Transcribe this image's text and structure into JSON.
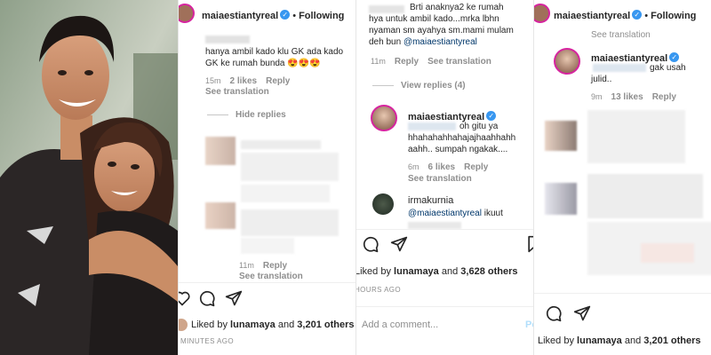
{
  "panel2": {
    "header": {
      "username": "maiaestiantyreal",
      "following": "Following"
    },
    "comment1": {
      "text": "hanya ambil kado klu GK ada kado GK ke rumah bunda",
      "emojis": "😍😍😍",
      "time": "15m",
      "likes": "2 likes",
      "reply": "Reply",
      "see_translation": "See translation"
    },
    "hide_replies": "Hide replies",
    "comment2": {
      "time": "11m",
      "reply": "Reply",
      "see_translation": "See translation"
    },
    "likes": {
      "prefix": "Liked by",
      "user": "lunamaya",
      "and": "and",
      "others": "3,201 others"
    },
    "ago": "MINUTES AGO"
  },
  "panel3": {
    "comment1": {
      "line1": "Brti anaknya2 ke rumah",
      "line2": "hya untuk ambil kado...mrka lbhn",
      "line3": "nyaman sm ayahya sm.mami mulam",
      "line4": "deh bun",
      "mention": "@maiaestiantyreal",
      "time": "11m",
      "reply": "Reply",
      "see_translation": "See translation"
    },
    "view_replies": "View replies (4)",
    "reply1": {
      "username": "maiaestiantyreal",
      "line1": "oh gitu ya",
      "line2": "hhahahahhahajajhaahhahh",
      "line3": "aahh.. sumpah ngakak....",
      "time": "6m",
      "likes": "6 likes",
      "reply": "Reply",
      "see_translation": "See translation"
    },
    "reply2": {
      "username": "irmakurnia",
      "mention": "@maiaestiantyreal",
      "text": "ikuut"
    },
    "likes": {
      "prefix": "Liked by",
      "user": "lunamaya",
      "and": "and",
      "others": "3,628 others"
    },
    "ago": "HOURS AGO",
    "add_comment": "Add a comment...",
    "post": "Po"
  },
  "panel4": {
    "header": {
      "username": "maiaestiantyreal",
      "following": "Following"
    },
    "see_translation_top": "See translation",
    "comment1": {
      "username": "maiaestiantyreal",
      "text": "gak usah",
      "text2": "julid..",
      "time": "9m",
      "likes": "13 likes",
      "reply": "Reply"
    },
    "likes": {
      "prefix": "Liked by",
      "user": "lunamaya",
      "and": "and",
      "others": "3,201 others"
    }
  },
  "colors": {
    "verified": "#3897f0",
    "mention": "#00376b",
    "meta": "#8e8e8e"
  },
  "icons": [
    "heart-icon",
    "comment-icon",
    "share-icon",
    "verified-icon"
  ]
}
